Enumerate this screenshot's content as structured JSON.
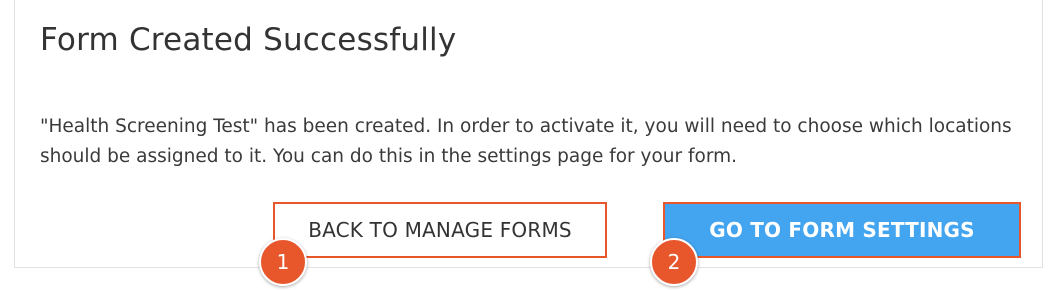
{
  "dialog": {
    "title": "Form Created Successfully",
    "message": "\"Health Screening Test\" has been created. In order to activate it, you will need to choose which locations should be assigned to it. You can do this in the settings page for your form.",
    "back_button_label": "BACK TO MANAGE FORMS",
    "settings_button_label": "GO TO FORM SETTINGS"
  },
  "callouts": {
    "first": "1",
    "second": "2"
  },
  "colors": {
    "accent_orange": "#e8562c",
    "primary_blue": "#43a4ef",
    "text_dark": "#333333"
  }
}
